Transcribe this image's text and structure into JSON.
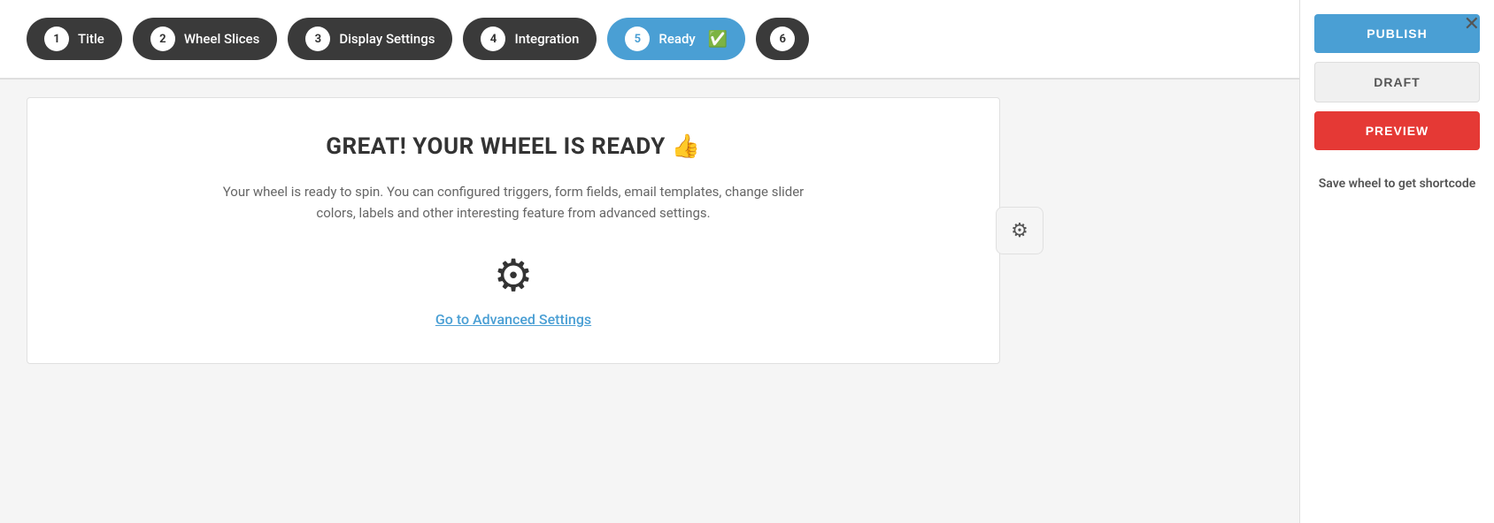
{
  "steps": [
    {
      "number": "1",
      "label": "Title",
      "active": false
    },
    {
      "number": "2",
      "label": "Wheel Slices",
      "active": false
    },
    {
      "number": "3",
      "label": "Display Settings",
      "active": false
    },
    {
      "number": "4",
      "label": "Integration",
      "active": false
    },
    {
      "number": "5",
      "label": "Ready",
      "active": true,
      "check": "✔"
    },
    {
      "number": "6",
      "label": "",
      "active": false
    }
  ],
  "main": {
    "title": "GREAT! YOUR WHEEL IS READY 👍",
    "description": "Your wheel is ready to spin. You can configured triggers, form fields, email templates, change slider colors, labels and other interesting feature from advanced settings.",
    "goto_link": "Go to Advanced Settings"
  },
  "sidebar": {
    "publish_label": "PUBLISH",
    "draft_label": "DRAFT",
    "preview_label": "PREVIEW",
    "shortcode_text": "Save wheel to get shortcode"
  },
  "close_icon": "✕"
}
